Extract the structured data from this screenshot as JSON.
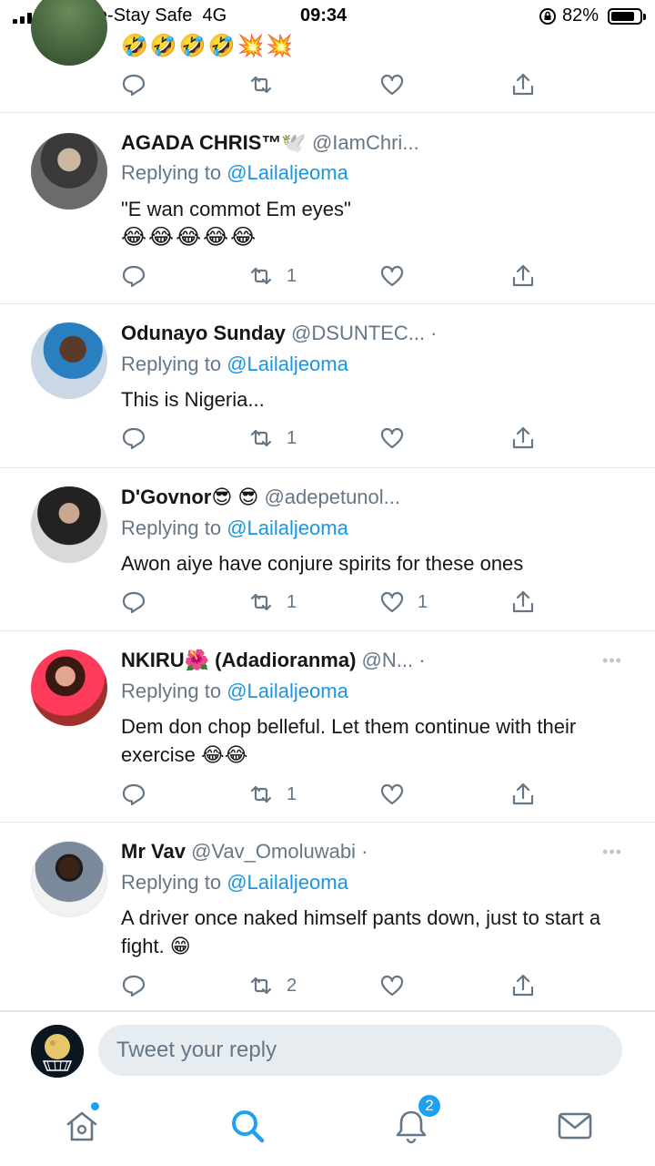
{
  "status": {
    "carrier": "9mobile-Stay Safe",
    "network": "4G",
    "time": "09:34",
    "battery": "82%",
    "battery_level": 0.82
  },
  "top_partial": {
    "emojis": "🤣🤣🤣🤣💥💥"
  },
  "tweets": [
    {
      "name": "AGADA CHRIS™🕊️",
      "handle": "@IamChri...",
      "replying_prefix": "Replying to",
      "replying_to": "@Lailaljeoma",
      "text": "\"E wan commot Em eyes\"",
      "emojis": "😂😂😂😂😂",
      "retweets": "1",
      "likes": ""
    },
    {
      "name": "Odunayo Sunday",
      "handle": "@DSUNTEC... ·",
      "replying_prefix": "Replying to",
      "replying_to": "@Lailaljeoma",
      "text": "This is Nigeria...",
      "retweets": "1",
      "likes": ""
    },
    {
      "name": "D'Govnor😎 😎",
      "handle": "@adepetunol...",
      "replying_prefix": "Replying to",
      "replying_to": "@Lailaljeoma",
      "text": "Awon aiye have conjure spirits for these ones",
      "retweets": "1",
      "likes": "1"
    },
    {
      "name": "NKIRU🌺 (Adadioranma)",
      "handle": "@N... ·",
      "replying_prefix": "Replying to",
      "replying_to": "@Lailaljeoma",
      "text": "Dem don chop belleful. Let them continue with their exercise 😂😂",
      "retweets": "1",
      "likes": ""
    },
    {
      "name": "Mr Vav",
      "handle": "@Vav_Omoluwabi ·",
      "replying_prefix": "Replying to",
      "replying_to": "@Lailaljeoma",
      "text": "A driver once naked himself pants down, just to start a fight. 😁",
      "retweets": "2",
      "likes": ""
    }
  ],
  "reply_box": {
    "placeholder": "Tweet your reply"
  },
  "tabbar": {
    "notifications_badge": "2"
  },
  "colors": {
    "accent": "#1da1f2",
    "link": "#1b95e0",
    "muted": "#657786",
    "divider": "#e1e8ed"
  }
}
